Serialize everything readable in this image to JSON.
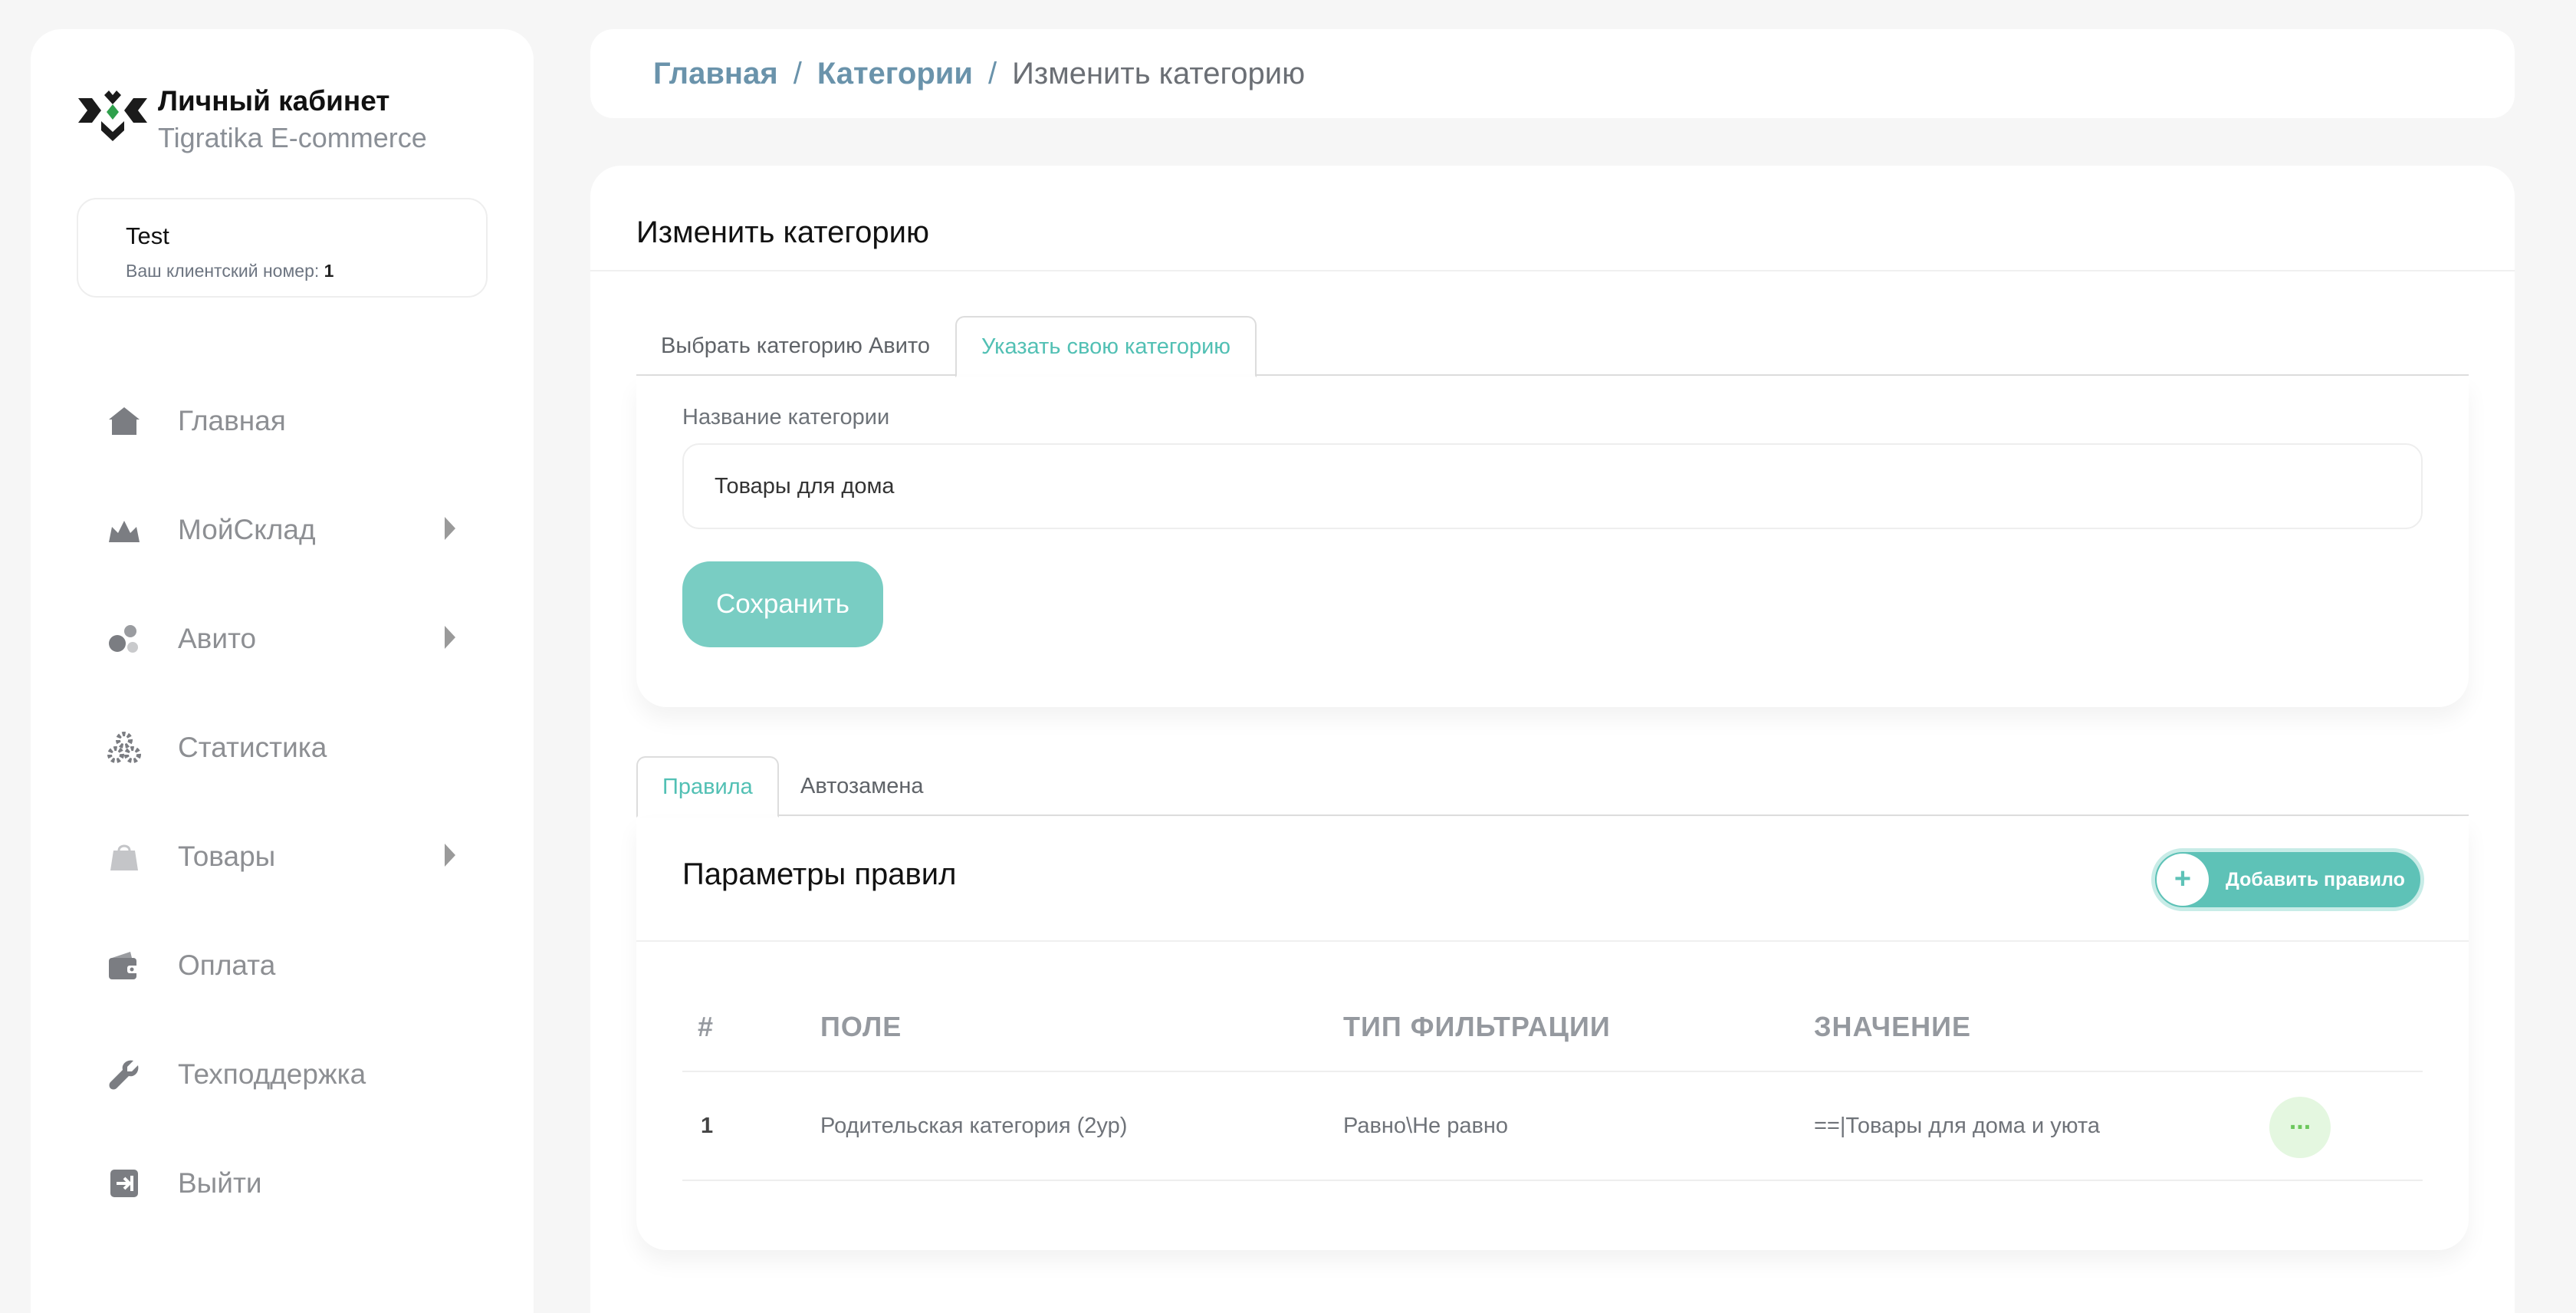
{
  "brand": {
    "title": "Личный кабинет",
    "subtitle": "Tigratika E-commerce",
    "logo_icon": "tiger-arrows-logo",
    "accent_color": "#2fa04c"
  },
  "user": {
    "name": "Test",
    "client_label": "Ваш клиентский номер:",
    "client_number": "1"
  },
  "nav": {
    "items": [
      {
        "label": "Главная",
        "icon": "home-icon",
        "has_submenu": false
      },
      {
        "label": "МойСклад",
        "icon": "warehouse-icon",
        "has_submenu": true
      },
      {
        "label": "Авито",
        "icon": "avito-icon",
        "has_submenu": true
      },
      {
        "label": "Статистика",
        "icon": "stats-icon",
        "has_submenu": false
      },
      {
        "label": "Товары",
        "icon": "shopping-bag-icon",
        "has_submenu": true
      },
      {
        "label": "Оплата",
        "icon": "wallet-icon",
        "has_submenu": false
      },
      {
        "label": "Техподдержка",
        "icon": "wrench-icon",
        "has_submenu": false
      },
      {
        "label": "Выйти",
        "icon": "logout-icon",
        "has_submenu": false
      }
    ]
  },
  "breadcrumb": {
    "home": "Главная",
    "sep": "/",
    "categories": "Категории",
    "current": "Изменить категорию"
  },
  "edit": {
    "title": "Изменить категорию",
    "tabs": [
      {
        "label": "Выбрать категорию Авито",
        "active": false
      },
      {
        "label": "Указать свою категорию",
        "active": true
      }
    ],
    "field_label": "Название категории",
    "field_value": "Товары для дома",
    "save_label": "Сохранить"
  },
  "rules": {
    "tabs": [
      {
        "label": "Правила",
        "active": true
      },
      {
        "label": "Автозамена",
        "active": false
      }
    ],
    "title": "Параметры правил",
    "add_label": "Добавить правило",
    "add_plus": "+",
    "columns": [
      "#",
      "ПОЛЕ",
      "ТИП ФИЛЬТРАЦИИ",
      "ЗНАЧЕНИЕ"
    ],
    "rows": [
      {
        "num": "1",
        "field": "Родительская категория (2ур)",
        "filter_type": "Равно\\Не равно",
        "value": "==|Товары для дома и уюта",
        "action": "..."
      }
    ]
  },
  "colors": {
    "primary": "#79cdc3",
    "tab_active": "#52c0b4",
    "breadcrumb_link": "#6a93ab",
    "action_bg": "#e4f7e0"
  }
}
